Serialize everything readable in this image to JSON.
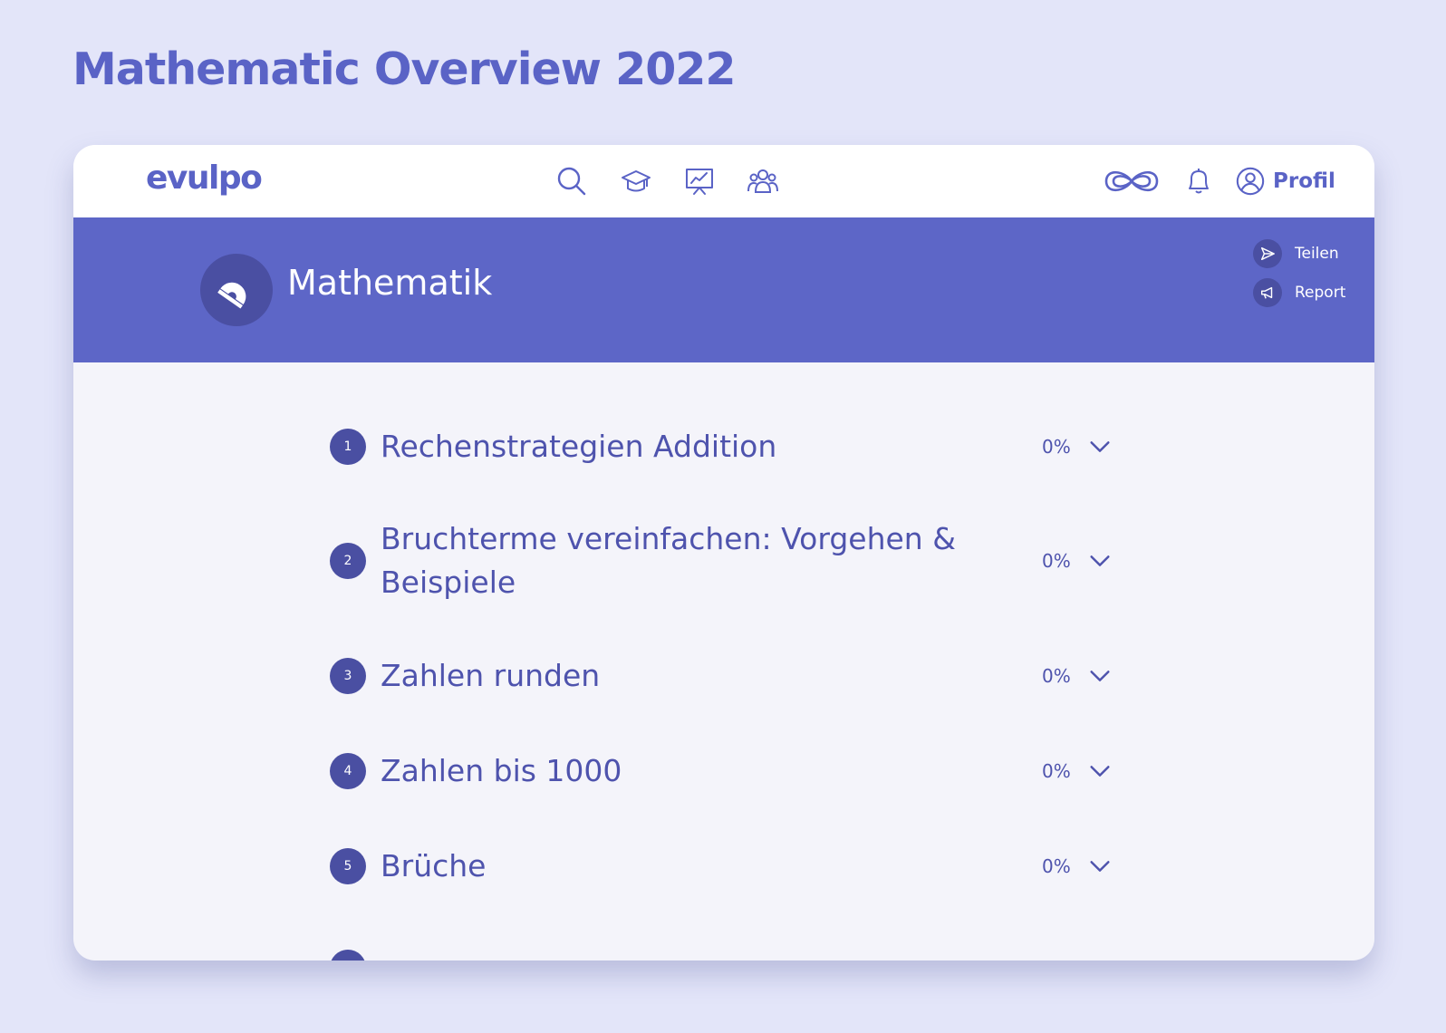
{
  "page": {
    "title": "Mathematic Overview 2022"
  },
  "nav": {
    "logo": "evulpo",
    "icons": [
      "search-icon",
      "graduation-cap-icon",
      "presentation-chart-icon",
      "users-icon",
      "infinity-icon",
      "bell-icon",
      "user-circle-icon"
    ],
    "profile_label": "Profil"
  },
  "subject": {
    "title": "Mathematik",
    "icon": "protractor-icon",
    "actions": [
      {
        "label": "Teilen",
        "icon": "send-icon"
      },
      {
        "label": "Report",
        "icon": "megaphone-icon"
      }
    ]
  },
  "topics": [
    {
      "number": "1",
      "title": "Rechenstrategien Addition",
      "progress": "0%"
    },
    {
      "number": "2",
      "title": "Bruchterme vereinfachen: Vorgehen & Beispiele",
      "progress": "0%"
    },
    {
      "number": "3",
      "title": "Zahlen runden",
      "progress": "0%"
    },
    {
      "number": "4",
      "title": "Zahlen bis 1000",
      "progress": "0%"
    },
    {
      "number": "5",
      "title": "Brüche",
      "progress": "0%"
    }
  ],
  "colors": {
    "page_background": "#e3e5f9",
    "brand": "#5a63c6",
    "banner": "#5d66c7",
    "dark_accent": "#4a4fa2",
    "content_background": "#f4f4fa"
  }
}
